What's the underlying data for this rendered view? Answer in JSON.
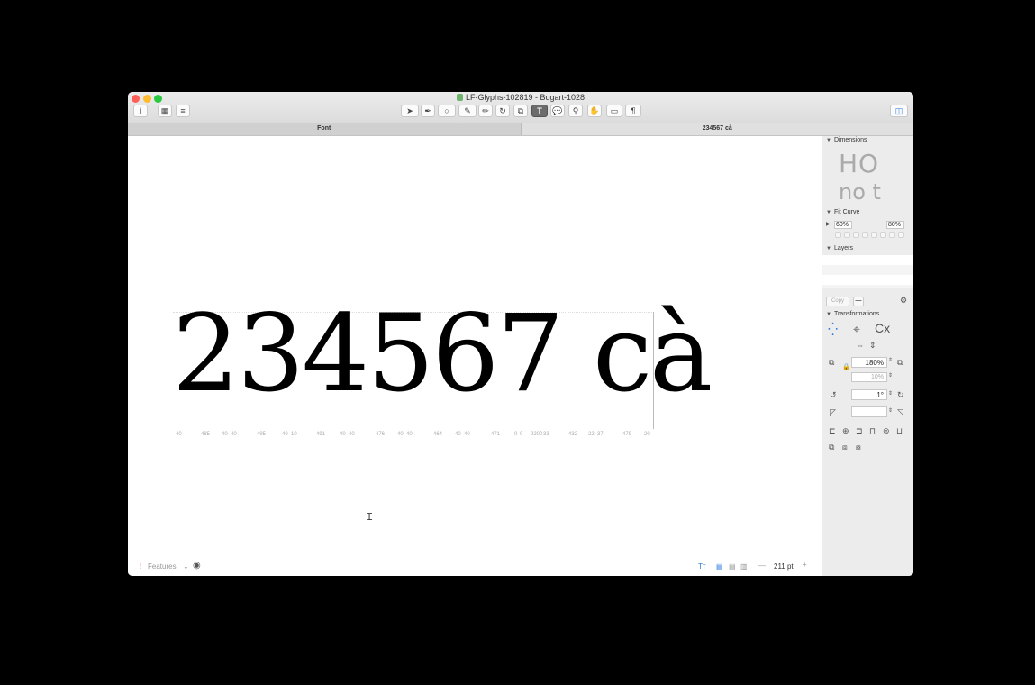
{
  "window": {
    "title": "LF-Glyphs-102819 - Bogart-1028"
  },
  "toolbar": {
    "info_label": "i",
    "text_tool_label": "T",
    "tools": [
      "select-tool",
      "draw-tool",
      "primitives-tool",
      "pen-tool",
      "pencil-tool",
      "rotate-tool",
      "scale-tool",
      "text-tool",
      "annotation-tool",
      "zoom-tool",
      "hand-tool",
      "measure-tool",
      "type-tool"
    ]
  },
  "tabs": [
    {
      "label": "Font"
    },
    {
      "label": "234567 cà"
    }
  ],
  "edit": {
    "text": "234567 cà",
    "metrics": [
      "40",
      "485",
      "40",
      "40",
      "495",
      "40",
      "10",
      "491",
      "40",
      "40",
      "476",
      "40",
      "40",
      "464",
      "40",
      "40",
      "471",
      "0",
      "0",
      "2200",
      "33",
      "432",
      "22",
      "37",
      "479",
      "20"
    ]
  },
  "bottom": {
    "features_label": "Features",
    "size_label": "211 pt",
    "minus": "—",
    "plus": "+"
  },
  "sidebar": {
    "dimensions_label": "Dimensions",
    "dim_sample_top": "HO",
    "dim_sample_bottom": "no t",
    "fit_curve_label": "Fit Curve",
    "fit_min": "60%",
    "fit_max": "80%",
    "layers_label": "Layers",
    "copy_label": "Copy",
    "transformations_label": "Transformations",
    "scale_value": "180%",
    "scale_secondary": "10%",
    "rotate_value": "1°",
    "slant_value": ""
  }
}
